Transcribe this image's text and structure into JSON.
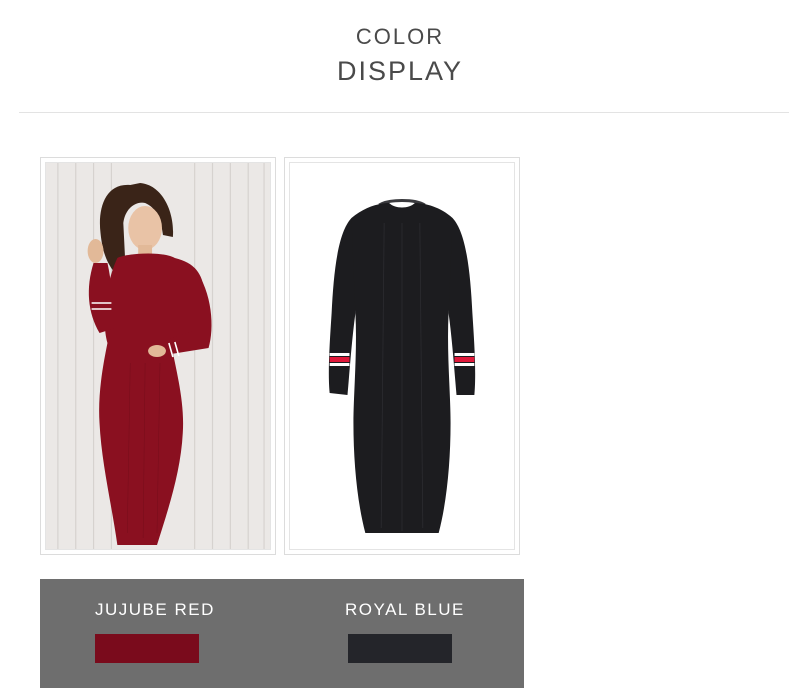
{
  "header": {
    "title_line1": "COLOR",
    "title_line2": "DISPLAY"
  },
  "products": [
    {
      "icon": "model-photo-red-dress"
    },
    {
      "icon": "product-photo-black-dress"
    }
  ],
  "swatches": [
    {
      "label": "JUJUBE RED",
      "color": "#7a0b1c"
    },
    {
      "label": "ROYAL BLUE",
      "color": "#24252a"
    }
  ]
}
